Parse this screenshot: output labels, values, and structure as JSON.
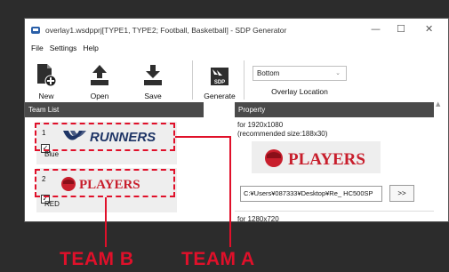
{
  "window": {
    "title": "overlay1.wsdpprj[TYPE1, TYPE2; Football, Basketball] - SDP Generator",
    "minimize_glyph": "—",
    "maximize_glyph": "☐",
    "close_glyph": "✕"
  },
  "menu": [
    "File",
    "Settings",
    "Help"
  ],
  "toolbar": {
    "new_label": "New",
    "open_label": "Open",
    "save_label": "Save",
    "generate_label": "Generate",
    "overlay_location_value": "Bottom",
    "overlay_location_label": "Overlay Location"
  },
  "team_list": {
    "header": "Team List",
    "items": [
      {
        "number": "1",
        "logo_text": "RUNNERS",
        "name": "Blue",
        "checked": true
      },
      {
        "number": "2",
        "logo_text": "PLAYERS",
        "name": "RED",
        "checked": true
      }
    ]
  },
  "property": {
    "header": "Property",
    "size_line1": "for 1920x1080",
    "size_line2": "(recommended size:188x30)",
    "logo_text": "PLAYERS",
    "path_value": "C:¥Users¥087333¥Desktop¥Re_ HC500SP",
    "browse_label": ">>",
    "size2_line": "for 1280x720"
  },
  "callouts": {
    "team_b": "TEAM B",
    "team_a": "TEAM A"
  },
  "colors": {
    "accent_red": "#e0102a",
    "logo_navy": "#1f3566",
    "header_gray": "#4a4a4a",
    "dark_background": "#2c2c2c"
  },
  "icons": {
    "app": "app-icon",
    "new": "new-file-icon",
    "open": "open-upload-icon",
    "save": "save-download-icon",
    "generate": "sdp-generate-icon"
  }
}
